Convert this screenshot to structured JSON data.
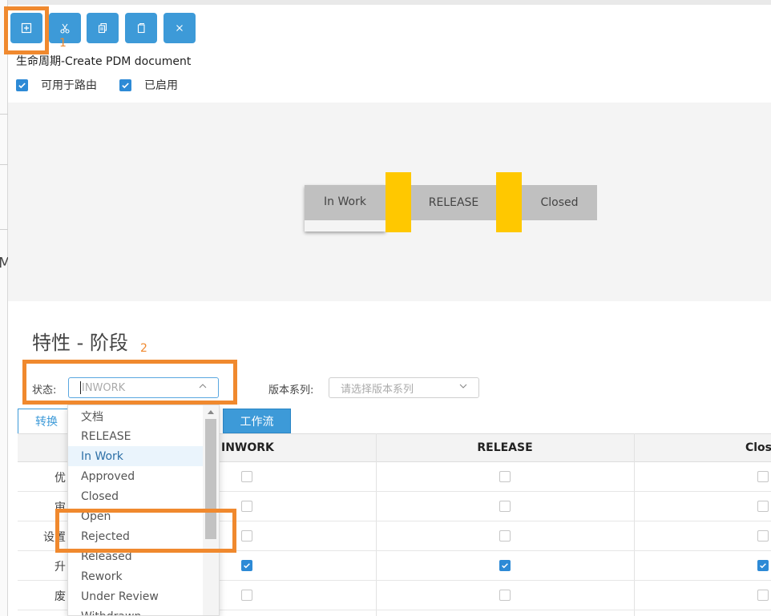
{
  "toolbar": {
    "buttons": [
      {
        "name": "add",
        "icon": "plus-square-icon"
      },
      {
        "name": "cut",
        "icon": "scissors-icon"
      },
      {
        "name": "copy",
        "icon": "copy-icon"
      },
      {
        "name": "paste",
        "icon": "paste-icon"
      },
      {
        "name": "delete",
        "icon": "close-icon"
      }
    ]
  },
  "lifecycle": {
    "title": "生命周期-Create PDM document",
    "routing_checkbox_label": "可用于路由",
    "enabled_checkbox_label": "已启用",
    "routing_checked": true,
    "enabled_checked": true
  },
  "diagram": {
    "states": [
      "In Work",
      "RELEASE",
      "Closed"
    ]
  },
  "properties": {
    "title": "特性 - 阶段",
    "state_label": "状态:",
    "state_value": "INWORK",
    "version_label": "版本系列:",
    "version_placeholder": "请选择版本系列",
    "tabs": [
      "转换",
      "工作流"
    ]
  },
  "dropdown": {
    "options": [
      "文档",
      "RELEASE",
      "In Work",
      "Approved",
      "Closed",
      "Open",
      "Rejected",
      "Released",
      "Rework",
      "Under Review",
      "Withdrawn"
    ],
    "selected": "In Work"
  },
  "grid": {
    "columns": [
      "INWORK",
      "RELEASE",
      "Clos"
    ],
    "rows": [
      {
        "label": "优",
        "values": [
          false,
          false,
          false
        ]
      },
      {
        "label": "审",
        "values": [
          false,
          false,
          false
        ]
      },
      {
        "label": "设置",
        "values": [
          false,
          false,
          false
        ]
      },
      {
        "label": "升",
        "values": [
          true,
          true,
          true
        ]
      },
      {
        "label": "废",
        "values": [
          false,
          false,
          false
        ]
      }
    ]
  },
  "annotations": {
    "marker1": "1",
    "marker2": "2"
  },
  "colors": {
    "accent": "#3d9ad8",
    "transition": "#ffc800",
    "highlight": "#f0892e"
  }
}
